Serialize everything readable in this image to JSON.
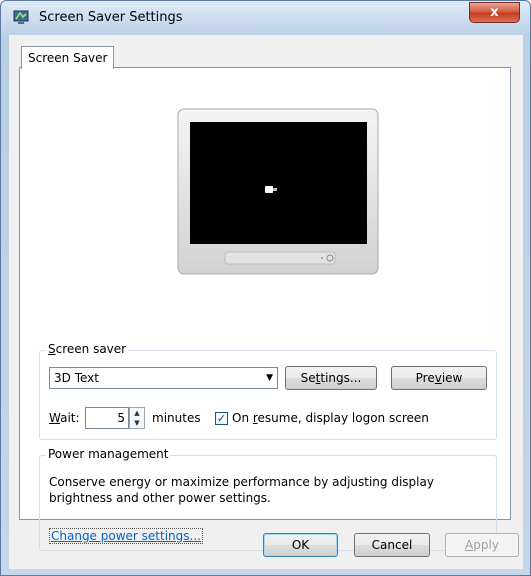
{
  "window": {
    "title": "Screen Saver Settings",
    "close_label": "x"
  },
  "tabs": [
    {
      "label": "Screen Saver"
    }
  ],
  "screen_saver": {
    "group_label": "Screen saver",
    "group_label_access": "S",
    "group_label_rest": "creen saver",
    "selected": "3D Text",
    "settings_button": {
      "pre": "Se",
      "u": "t",
      "post": "tings..."
    },
    "preview_button": {
      "pre": "Pre",
      "u": "v",
      "post": "iew"
    },
    "wait_label": {
      "u": "W",
      "post": "ait:"
    },
    "wait_value": "5",
    "minutes_label": "minutes",
    "resume_checkbox_checked": true,
    "resume_label": {
      "pre": "On ",
      "u": "r",
      "post": "esume, display logon screen"
    }
  },
  "power": {
    "group_label": "Power management",
    "description_line1": "Conserve energy or maximize performance by adjusting display",
    "description_line2": "brightness and other power settings.",
    "link": "Change power settings..."
  },
  "buttons": {
    "ok": "OK",
    "cancel": "Cancel",
    "apply": {
      "u": "A",
      "post": "pply"
    }
  },
  "colors": {
    "link": "#0066cc",
    "monitor_screen": "#000000",
    "close_button": "#c23a1d"
  },
  "icons": {
    "app": "screen-saver-app-icon",
    "power_led": "power-indicator-icon",
    "cursor_preview": "3d-text-preview-glyph"
  }
}
